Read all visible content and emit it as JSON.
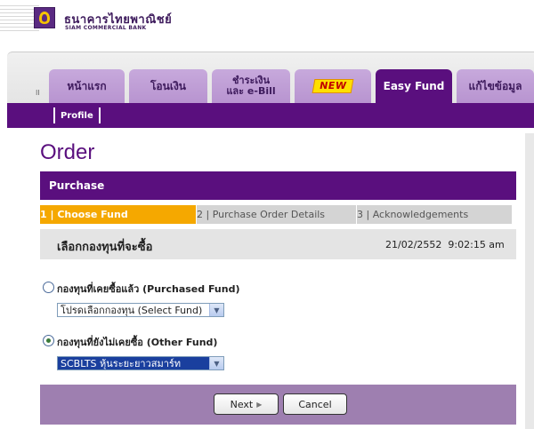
{
  "header": {
    "bank_name_th": "ธนาคารไทยพาณิชย์",
    "bank_name_en": "SIAM COMMERCIAL BANK"
  },
  "tabs": [
    {
      "label": "หน้าแรก"
    },
    {
      "label": "โอนเงิน"
    },
    {
      "label": "ชำระเงิน และ e-Bill"
    },
    {
      "label": "NEW"
    },
    {
      "label": "Easy Fund",
      "active": true
    },
    {
      "label": "แก้ไขข้อมูล"
    }
  ],
  "tab_handle": "II",
  "subnav": {
    "profile": "Profile"
  },
  "page": {
    "title": "Order"
  },
  "section": {
    "title": "Purchase"
  },
  "steps": [
    {
      "label": "1 | Choose Fund",
      "active": true
    },
    {
      "label": "2 | Purchase Order Details"
    },
    {
      "label": "3 | Acknowledgements"
    }
  ],
  "fund_header": {
    "title": "เลือกกองทุนที่จะซื้อ",
    "date": "21/02/2552",
    "time": "9:02:15 am"
  },
  "purchased_fund": {
    "label": "กองทุนที่เคยซื้อแล้ว (Purchased Fund)",
    "checked": false,
    "select_value": "โปรดเลือกกองทุน (Select Fund)"
  },
  "other_fund": {
    "label": "กองทุนที่ยังไม่เคยซื้อ (Other Fund)",
    "checked": true,
    "select_value": "SCBLTS หุ้นระยะยาวสมาร์ท"
  },
  "buttons": {
    "next": "Next",
    "cancel": "Cancel"
  },
  "colors": {
    "brand_purple": "#5a0f7e",
    "tab_lavender": "#c7a9dc",
    "step_active": "#f5a800",
    "footer_purple": "#9e7fb0"
  }
}
